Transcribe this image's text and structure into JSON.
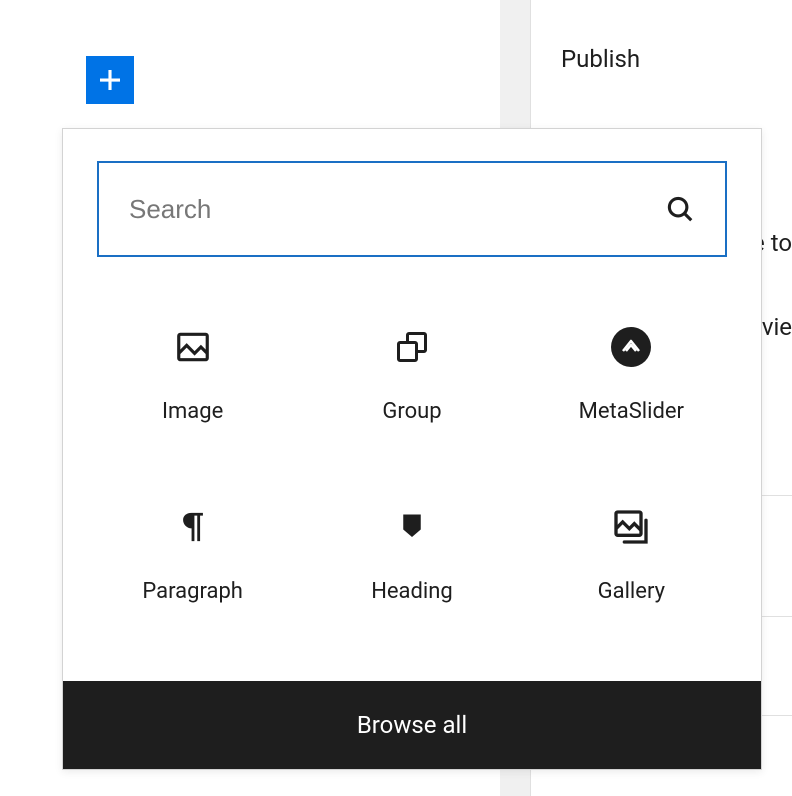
{
  "sidebar": {
    "publish_label": "Publish",
    "partial_text_1": "e to",
    "partial_text_2": "vie"
  },
  "inserter": {
    "search_placeholder": "Search",
    "browse_all_label": "Browse all",
    "blocks": [
      {
        "label": "Image",
        "icon": "image-icon"
      },
      {
        "label": "Group",
        "icon": "group-icon"
      },
      {
        "label": "MetaSlider",
        "icon": "metaslider-icon"
      },
      {
        "label": "Paragraph",
        "icon": "paragraph-icon"
      },
      {
        "label": "Heading",
        "icon": "heading-icon"
      },
      {
        "label": "Gallery",
        "icon": "gallery-icon"
      }
    ]
  }
}
